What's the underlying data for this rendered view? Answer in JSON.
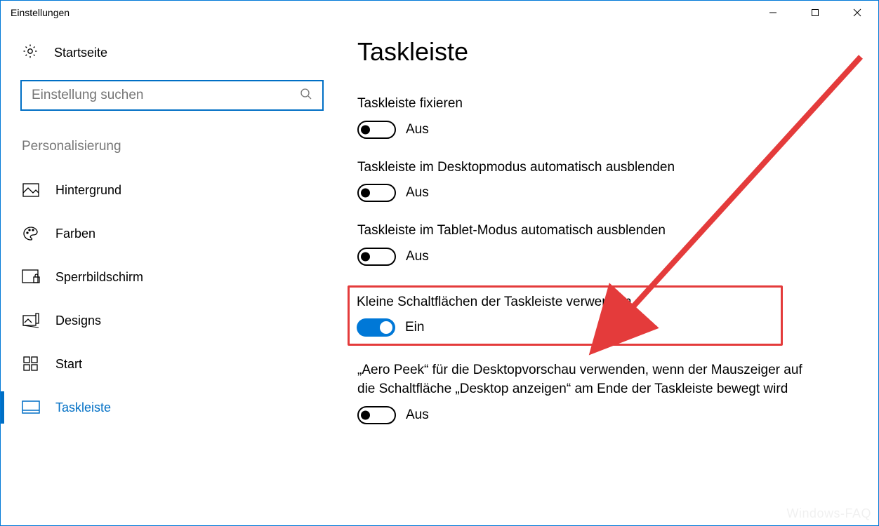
{
  "window": {
    "title": "Einstellungen"
  },
  "sidebar": {
    "home_label": "Startseite",
    "search_placeholder": "Einstellung suchen",
    "section_label": "Personalisierung",
    "items": [
      {
        "label": "Hintergrund",
        "icon": "picture-icon",
        "active": false
      },
      {
        "label": "Farben",
        "icon": "palette-icon",
        "active": false
      },
      {
        "label": "Sperrbildschirm",
        "icon": "lockscreen-icon",
        "active": false
      },
      {
        "label": "Designs",
        "icon": "designs-icon",
        "active": false
      },
      {
        "label": "Start",
        "icon": "start-icon",
        "active": false
      },
      {
        "label": "Taskleiste",
        "icon": "taskbar-icon",
        "active": true
      }
    ]
  },
  "main": {
    "title": "Taskleiste",
    "settings": [
      {
        "label": "Taskleiste fixieren",
        "state": "Aus",
        "on": false,
        "highlight": false
      },
      {
        "label": "Taskleiste im Desktopmodus automatisch ausblenden",
        "state": "Aus",
        "on": false,
        "highlight": false
      },
      {
        "label": "Taskleiste im Tablet-Modus automatisch ausblenden",
        "state": "Aus",
        "on": false,
        "highlight": false
      },
      {
        "label": "Kleine Schaltflächen der Taskleiste verwenden",
        "state": "Ein",
        "on": true,
        "highlight": true
      },
      {
        "label": "„Aero Peek“ für die Desktopvorschau verwenden, wenn der Mauszeiger auf die Schaltfläche „Desktop anzeigen“ am Ende der Taskleiste bewegt wird",
        "state": "Aus",
        "on": false,
        "highlight": false
      }
    ]
  },
  "annotation": {
    "arrow_color": "#e43b3b",
    "highlight_color": "#e43b3b"
  },
  "watermark": "Windows-FAQ"
}
